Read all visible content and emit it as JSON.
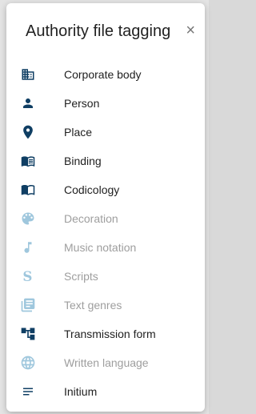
{
  "dialog": {
    "title": "Authority file tagging",
    "close_label": "×"
  },
  "colors": {
    "active_icon": "#0f3e63",
    "disabled_icon": "#9fc7dd",
    "active_text": "#212121",
    "disabled_text": "#9e9e9e"
  },
  "items": [
    {
      "label": "Corporate body",
      "icon": "domain-icon",
      "enabled": true
    },
    {
      "label": "Person",
      "icon": "person-icon",
      "enabled": true
    },
    {
      "label": "Place",
      "icon": "place-icon",
      "enabled": true
    },
    {
      "label": "Binding",
      "icon": "book-open-icon",
      "enabled": true
    },
    {
      "label": "Codicology",
      "icon": "book-map-icon",
      "enabled": true
    },
    {
      "label": "Decoration",
      "icon": "palette-icon",
      "enabled": false
    },
    {
      "label": "Music notation",
      "icon": "music-note-icon",
      "enabled": false
    },
    {
      "label": "Scripts",
      "icon": "script-s-icon",
      "enabled": false
    },
    {
      "label": "Text genres",
      "icon": "library-books-icon",
      "enabled": false
    },
    {
      "label": "Transmission form",
      "icon": "account-tree-icon",
      "enabled": true
    },
    {
      "label": "Written language",
      "icon": "globe-icon",
      "enabled": false
    },
    {
      "label": "Initium",
      "icon": "short-text-icon",
      "enabled": true
    }
  ]
}
